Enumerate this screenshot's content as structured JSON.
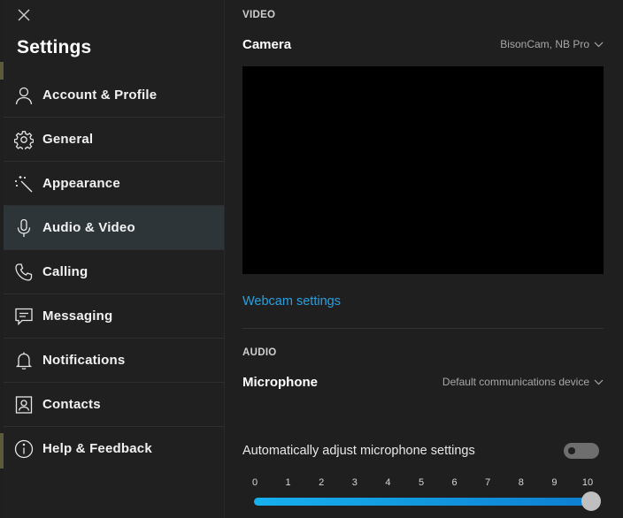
{
  "sidebar": {
    "title": "Settings",
    "items": [
      {
        "label": "Account & Profile",
        "icon": "person-icon"
      },
      {
        "label": "General",
        "icon": "gear-icon"
      },
      {
        "label": "Appearance",
        "icon": "magic-wand-icon"
      },
      {
        "label": "Audio & Video",
        "icon": "microphone-icon",
        "active": true
      },
      {
        "label": "Calling",
        "icon": "phone-icon"
      },
      {
        "label": "Messaging",
        "icon": "chat-icon"
      },
      {
        "label": "Notifications",
        "icon": "bell-icon"
      },
      {
        "label": "Contacts",
        "icon": "contact-card-icon"
      },
      {
        "label": "Help & Feedback",
        "icon": "info-icon"
      }
    ]
  },
  "video": {
    "section_label": "VIDEO",
    "camera_label": "Camera",
    "camera_value": "BisonCam, NB Pro",
    "webcam_settings_link": "Webcam settings"
  },
  "audio": {
    "section_label": "AUDIO",
    "microphone_label": "Microphone",
    "microphone_value": "Default communications device",
    "auto_adjust_label": "Automatically adjust microphone settings",
    "auto_adjust_enabled": false,
    "volume_ticks": [
      "0",
      "1",
      "2",
      "3",
      "4",
      "5",
      "6",
      "7",
      "8",
      "9",
      "10"
    ],
    "volume_value": 10,
    "volume_max": 10
  },
  "colors": {
    "accent": "#2aa0e0",
    "active_nav_bg": "#2e3539",
    "background": "#1f1f1f"
  }
}
